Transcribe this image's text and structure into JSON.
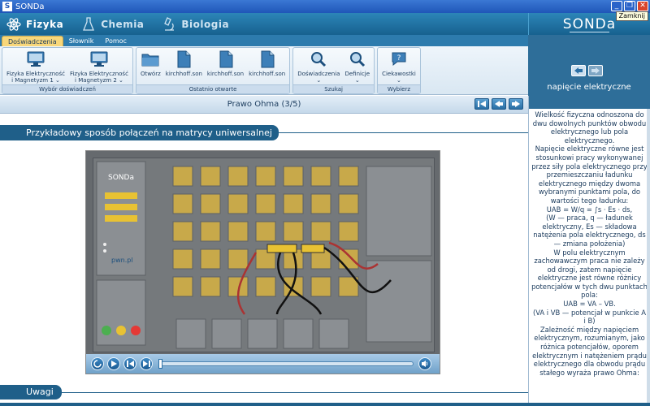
{
  "window": {
    "title": "SONDa",
    "tooltip": "Zamknij"
  },
  "topnav": {
    "items": [
      {
        "label": "Fizyka",
        "icon": "atom-icon"
      },
      {
        "label": "Chemia",
        "icon": "flask-icon"
      },
      {
        "label": "Biologia",
        "icon": "microscope-icon"
      }
    ]
  },
  "logo": "SONDa",
  "ribbon_tabs": [
    "Doświadczenia",
    "Słownik",
    "Pomoc"
  ],
  "ribbon_groups": [
    {
      "label": "Wybór doświadczeń",
      "buttons": [
        {
          "line1": "Fizyka Elektryczność",
          "line2": "i Magnetyzm 1 ⌄"
        },
        {
          "line1": "Fizyka Elektryczność",
          "line2": "i Magnetyzm 2 ⌄"
        }
      ]
    },
    {
      "label": "Ostatnio otwarte",
      "buttons": [
        {
          "line1": "Otwórz",
          "line2": ""
        },
        {
          "line1": "kirchhoff.son",
          "line2": ""
        },
        {
          "line1": "kirchhoff.son",
          "line2": ""
        },
        {
          "line1": "kirchhoff.son",
          "line2": ""
        }
      ]
    },
    {
      "label": "Szukaj",
      "buttons": [
        {
          "line1": "Doświadczenia",
          "line2": "⌄"
        },
        {
          "line1": "Definicje",
          "line2": "⌄"
        }
      ]
    },
    {
      "label": "Wybierz",
      "buttons": [
        {
          "line1": "Ciekawostki",
          "line2": "⌄"
        }
      ]
    }
  ],
  "sidebar": {
    "title": "napięcie elektryczne"
  },
  "pagebar": {
    "title": "Prawo Ohma (3/5)"
  },
  "content": {
    "section_title": "Przykładowy sposób połączeń na matrycy uniwersalnej",
    "notes_title": "Uwagi"
  },
  "video": {
    "progress": 0.0
  },
  "side_text": [
    "Wielkość fizyczna odnoszona do dwu dowolnych punktów obwodu elektrycznego lub pola elektrycznego.",
    "Napięcie elektryczne równe jest stosunkowi pracy wykonywanej przez siły pola elektrycznego przy przemieszczaniu ładunku elektrycznego między dwoma wybranymi punktami pola, do wartości tego ładunku:",
    "UAB = W/q = ∫s · Es · ds,",
    "(W — praca, q — ładunek elektryczny, Es — składowa natężenia pola elektrycznego, ds — zmiana położenia)",
    "W polu elektrycznym zachowawczym praca nie zależy od drogi, zatem napięcie elektryczne jest równe różnicy potencjałów w tych dwu punktach pola:",
    "UAB = VA – VB.",
    "(VA i VB — potencjał w punkcie A i B)",
    "Zależność między napięciem elektrycznym, rozumianym, jako różnica potencjałów, oporem elektrycznym i natężeniem prądu elektrycznego dla obwodu prądu stałego wyraża prawo Ohma:"
  ]
}
